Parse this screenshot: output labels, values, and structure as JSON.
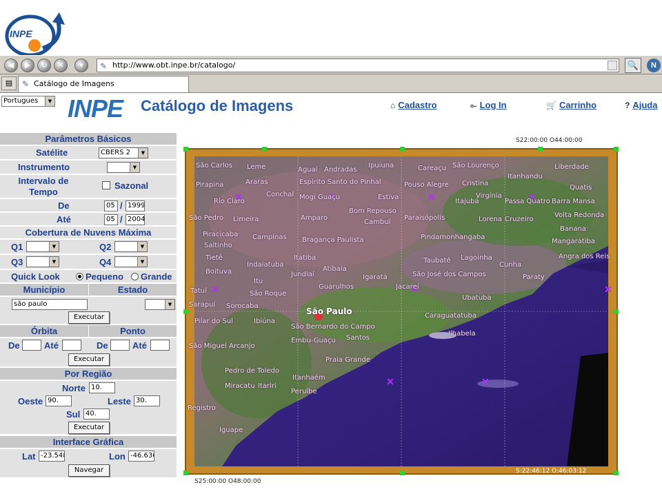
{
  "browser": {
    "url": "http://www.obt.inpe.br/catalogo/",
    "tab_title": "Catálogo de Imagens",
    "nav_icons": [
      "back-icon",
      "forward-icon",
      "reload-icon",
      "stop-icon",
      "home-icon"
    ]
  },
  "slide_logo": {
    "text": "INPE"
  },
  "header": {
    "language": "Portugues",
    "brand": "INPE",
    "title": "Catálogo de Imagens",
    "links": {
      "cadastro": "Cadastro",
      "login": "Log In",
      "carrinho": "Carrinho",
      "ajuda": "Ajuda"
    },
    "link_glyphs": {
      "cadastro": "⌂",
      "login": "⟜",
      "carrinho": "🛒",
      "ajuda": "?"
    }
  },
  "form": {
    "basic": {
      "header": "Parâmetros Básicos",
      "satellite_label": "Satélite",
      "satellite_value": "CBERS 2",
      "instrument_label": "Instrumento",
      "interval_label": "Intervalo de Tempo",
      "seasonal_label": "Sazonal",
      "from_label": "De",
      "from_month": "05",
      "from_year": "1999",
      "to_label": "Até",
      "to_month": "05",
      "to_year": "2004",
      "date_sep": "/",
      "cloud_header": "Cobertura de Nuvens Máxima",
      "q1": "Q1",
      "q2": "Q2",
      "q3": "Q3",
      "q4": "Q4",
      "quicklook_label": "Quick Look",
      "small_label": "Pequeno",
      "large_label": "Grande"
    },
    "municipio": {
      "municipio_header": "Município",
      "estado_header": "Estado",
      "value": "são paulo",
      "button": "Executar"
    },
    "orbita": {
      "orbita_header": "Órbita",
      "ponto_header": "Ponto",
      "de1": "De",
      "ate1": "Até",
      "de2": "De",
      "ate2": "Até",
      "button": "Executar"
    },
    "regiao": {
      "header": "Por Região",
      "norte_label": "Norte",
      "norte_value": "10.",
      "oeste_label": "Oeste",
      "oeste_value": "90.",
      "leste_label": "Leste",
      "leste_value": "30.",
      "sul_label": "Sul",
      "sul_value": "40.",
      "button": "Executar"
    },
    "grafica": {
      "header": "Interface Gráfica",
      "lat_label": "Lat",
      "lat_value": "-23.548",
      "lon_label": "Lon",
      "lon_value": "-46.636",
      "button": "Navegar"
    }
  },
  "map": {
    "top_coord": "S22:00:00 O44:00:00",
    "bottom_left_coord": "S25:00:00 O48:00:00",
    "bottom_right_coord": "S:22:46:12 O:46:03:12",
    "cities": [
      "São Carlos",
      "Leme",
      "Aguaí",
      "Andradas",
      "Ipuiuna",
      "Careaçu",
      "São Lourenço",
      "Liberdade",
      "Araras",
      "Espírito Santo do Pinhal",
      "Itanhandu",
      "Pirapina",
      "Conchal",
      "Pouso Alegre",
      "Cristina",
      "Quatis",
      "Rio Claro",
      "Mogi Guaçu",
      "Estiva",
      "Virgínia",
      "Passa Quatro",
      "Barra Mansa",
      "São Pedro",
      "Limeira",
      "Amparo",
      "Bom Repouso",
      "Itajubá",
      "Volta Redonda",
      "Paraisópolis",
      "Cambuí",
      "Lorena",
      "Cruzeiro",
      "Piracicaba",
      "Campinas",
      "Bragança Paulista",
      "Pindamonhangaba",
      "Banana",
      "Mangaratiba",
      "Saltinho",
      "Angra dos Reis",
      "Tietê",
      "Indaiatuba",
      "Itatiba",
      "Taubaté",
      "Lagoinha",
      "Cunha",
      "Boituva",
      "Jundiaí",
      "Atibaia",
      "Igaratá",
      "São José dos Campos",
      "Paraty",
      "Itu",
      "Jacareí",
      "Tatuí",
      "São Roque",
      "Guarulhos",
      "Ubatuba",
      "Sarapuí",
      "Sorocaba",
      "São Paulo",
      "Pilar do Sul",
      "Ibiúna",
      "Caraguatatuba",
      "São Bernardo do Campo",
      "Embu-Guaçu",
      "Santos",
      "Ilhabela",
      "São Miguel Arcanjo",
      "Praia Grande",
      "Pedro de Toledo",
      "Itanhaém",
      "Miracatu",
      "Itariri",
      "Peruíbe",
      "Registro",
      "Iguape"
    ]
  },
  "colors": {
    "form_header_bg": "#c8c8c8",
    "form_row_bg": "#e2e2e2",
    "label_blue": "#1f3f8f",
    "brand_blue": "#2a6fb8",
    "map_frame": "#c68a2a",
    "handle_green": "#2fd02f",
    "marker_purple": "#b030ff"
  }
}
